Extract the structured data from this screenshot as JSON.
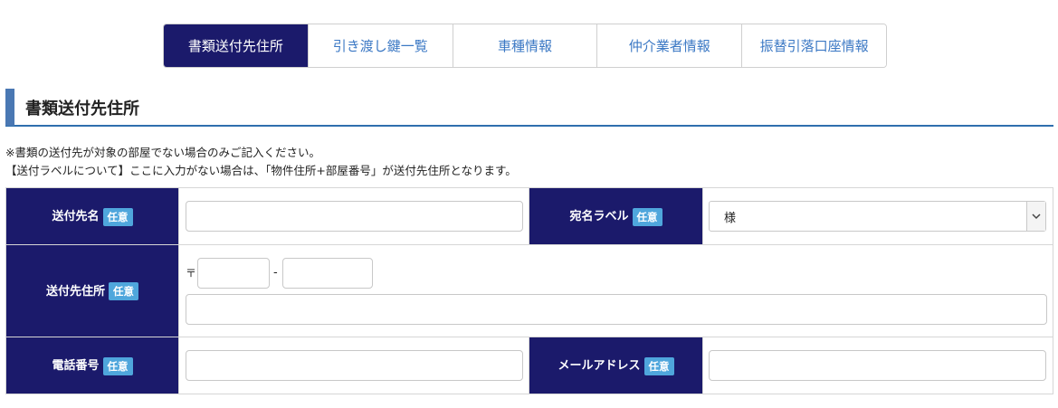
{
  "tabs": [
    {
      "label": "書類送付先住所",
      "active": true
    },
    {
      "label": "引き渡し鍵一覧",
      "active": false
    },
    {
      "label": "車種情報",
      "active": false
    },
    {
      "label": "仲介業者情報",
      "active": false
    },
    {
      "label": "振替引落口座情報",
      "active": false
    }
  ],
  "section": {
    "title": "書類送付先住所",
    "note1": "※書類の送付先が対象の部屋でない場合のみご記入ください。",
    "note2": "【送付ラベルについて】ここに入力がない場合は、「物件住所+部屋番号」が送付先住所となります。"
  },
  "badge": "任意",
  "form": {
    "recipient_label": "送付先名",
    "recipient_value": "",
    "address_label_label": "宛名ラベル",
    "address_label_value": "様",
    "address_label": "送付先住所",
    "zip_mark": "〒",
    "zip_dash": "-",
    "zip1": "",
    "zip2": "",
    "address_value": "",
    "phone_label": "電話番号",
    "phone_value": "",
    "email_label": "メールアドレス",
    "email_value": ""
  },
  "colors": {
    "accent": "#1b1a6b",
    "badge": "#4fa6dc",
    "tab_text": "#3b78c4",
    "heading_bar": "#4a78b3"
  },
  "icons": {
    "select_arrow": "chevron-down-icon"
  }
}
